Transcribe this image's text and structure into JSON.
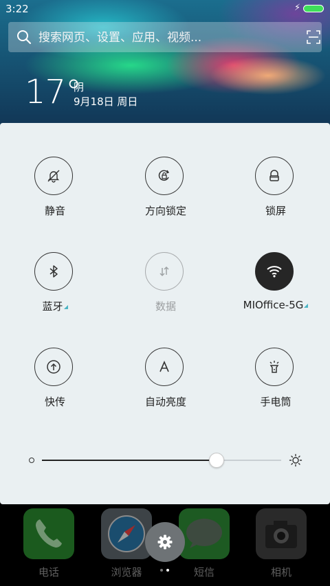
{
  "status_bar": {
    "time": "3:22",
    "battery_color": "#3ee05a"
  },
  "search": {
    "placeholder": "搜索网页、设置、应用、视频..."
  },
  "weather": {
    "temperature": "17°",
    "condition": "阴",
    "date": "9月18日 周日"
  },
  "toggles": [
    {
      "label": "静音",
      "icon": "bell-off-icon",
      "state": "off"
    },
    {
      "label": "方向锁定",
      "icon": "rotation-lock-icon",
      "state": "off"
    },
    {
      "label": "锁屏",
      "icon": "lock-icon",
      "state": "off"
    },
    {
      "label": "蓝牙",
      "icon": "bluetooth-icon",
      "state": "off",
      "expandable": true
    },
    {
      "label": "数据",
      "icon": "data-arrows-icon",
      "state": "disabled"
    },
    {
      "label": "MIOffice-5G",
      "icon": "wifi-icon",
      "state": "on",
      "expandable": true
    },
    {
      "label": "快传",
      "icon": "transfer-icon",
      "state": "off"
    },
    {
      "label": "自动亮度",
      "icon": "auto-brightness-icon",
      "state": "off"
    },
    {
      "label": "手电筒",
      "icon": "flashlight-icon",
      "state": "off"
    }
  ],
  "brightness": {
    "level": 0.73
  },
  "dock": {
    "apps": [
      {
        "label": "电话",
        "icon": "phone-icon"
      },
      {
        "label": "浏览器",
        "icon": "compass-icon"
      },
      {
        "label": "短信",
        "icon": "message-bubble-icon"
      },
      {
        "label": "相机",
        "icon": "camera-icon"
      }
    ],
    "settings_icon": "gear-icon",
    "page_count": 2,
    "active_page": 2
  },
  "colors": {
    "panel_bg": "#eaf0f2",
    "active_toggle": "#262626",
    "accent_triangle": "#4bb4c4"
  }
}
